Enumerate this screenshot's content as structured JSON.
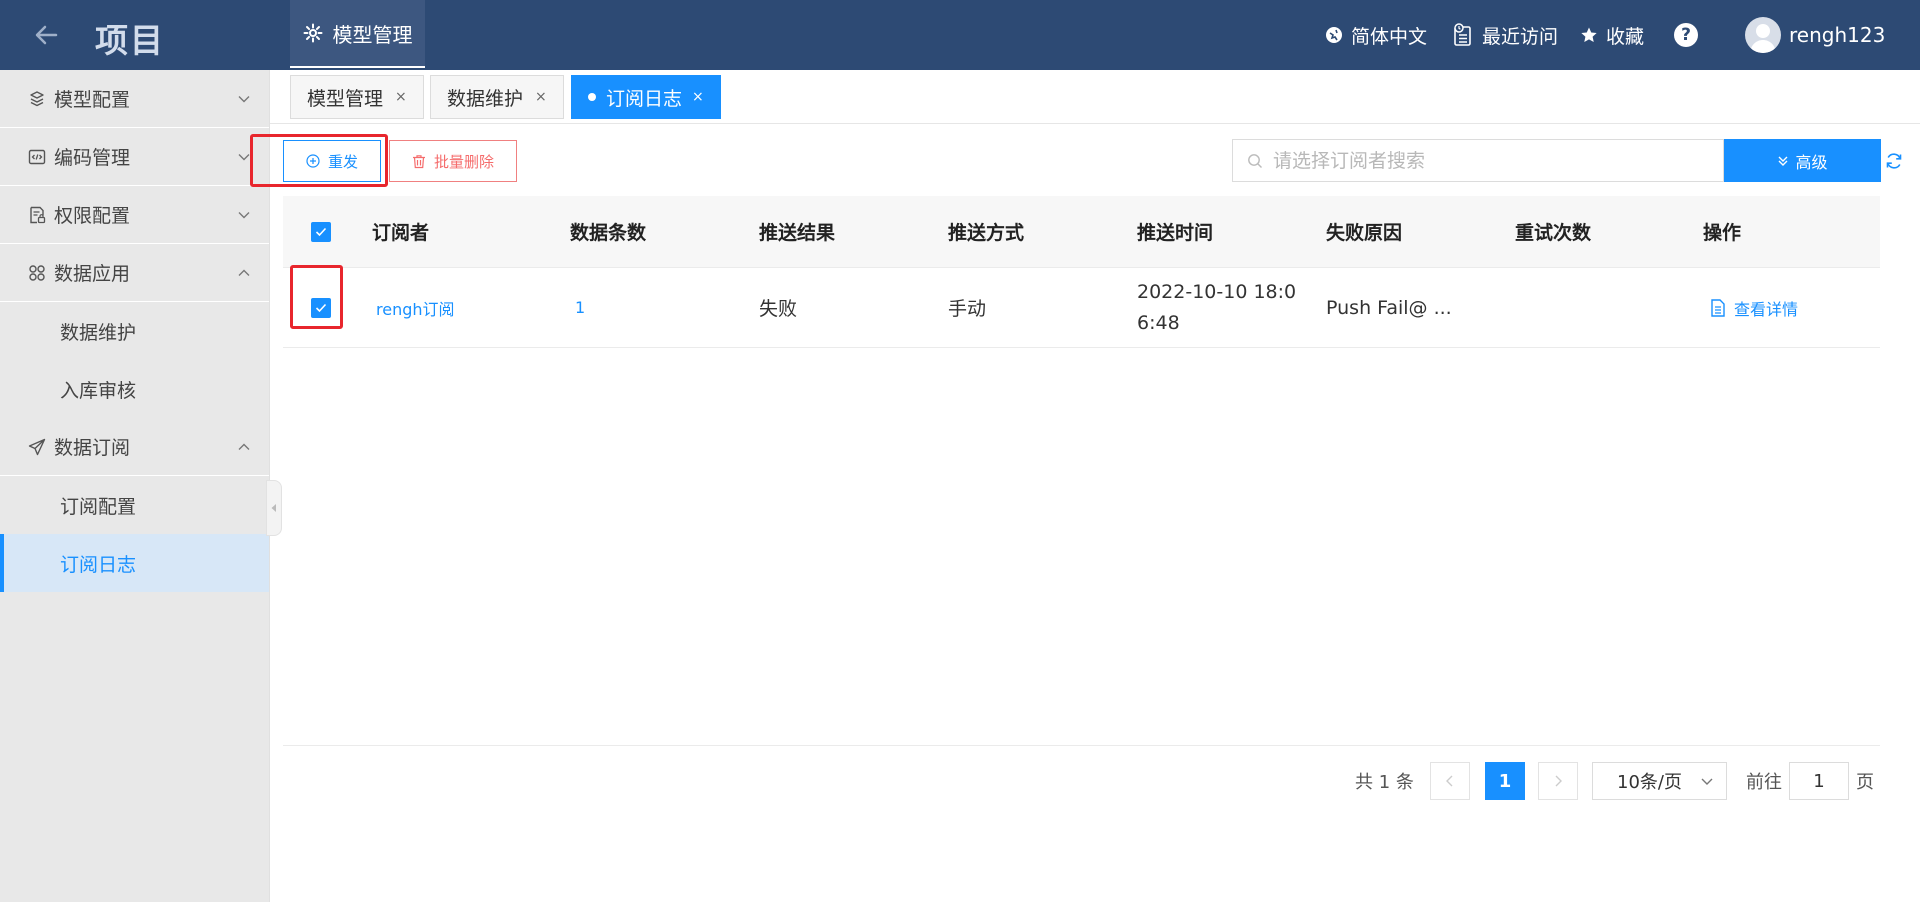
{
  "header": {
    "title": "项目",
    "active_nav": "模型管理",
    "language": "简体中文",
    "recent": "最近访问",
    "favorites": "收藏",
    "help": "?",
    "username": "rengh123"
  },
  "sidebar": {
    "groups": [
      {
        "label": "模型配置",
        "icon": "cube-stack-icon",
        "expanded": false
      },
      {
        "label": "编码管理",
        "icon": "code-icon",
        "expanded": false
      },
      {
        "label": "权限配置",
        "icon": "permission-doc-icon",
        "expanded": false
      },
      {
        "label": "数据应用",
        "icon": "grid-apps-icon",
        "expanded": true,
        "children": [
          "数据维护",
          "入库审核"
        ]
      },
      {
        "label": "数据订阅",
        "icon": "paper-plane-icon",
        "expanded": true,
        "children": [
          "订阅配置",
          "订阅日志"
        ]
      }
    ],
    "active_item": "订阅日志"
  },
  "tabs": [
    {
      "label": "模型管理",
      "close": "×",
      "active": false
    },
    {
      "label": "数据维护",
      "close": "×",
      "active": false
    },
    {
      "label": "订阅日志",
      "close": "×",
      "active": true
    }
  ],
  "toolbar": {
    "resend_label": "重发",
    "batch_delete_label": "批量删除",
    "search_placeholder": "请选择订阅者搜索",
    "advanced_label": "高级"
  },
  "table": {
    "columns": [
      "订阅者",
      "数据条数",
      "推送结果",
      "推送方式",
      "推送时间",
      "失败原因",
      "重试次数",
      "操作"
    ],
    "rows": [
      {
        "checked": true,
        "subscriber": "rengh订阅",
        "count": "1",
        "result": "失败",
        "method": "手动",
        "time": "2022-10-10 18:06:48",
        "time_line1": "2022-10-10 18:0",
        "time_line2": "6:48",
        "reason": "Push Fail@ ...",
        "retries": "",
        "action": "查看详情"
      }
    ],
    "header_checked": true
  },
  "pagination": {
    "total": "共 1 条",
    "current_page": "1",
    "page_size": "10条/页",
    "goto_label": "前往",
    "goto_value": "1",
    "page_suffix": "页"
  },
  "colors": {
    "header_bg": "#2d4a74",
    "primary": "#1890ff",
    "danger": "#f56c6c",
    "highlight_box": "#e8262d"
  }
}
